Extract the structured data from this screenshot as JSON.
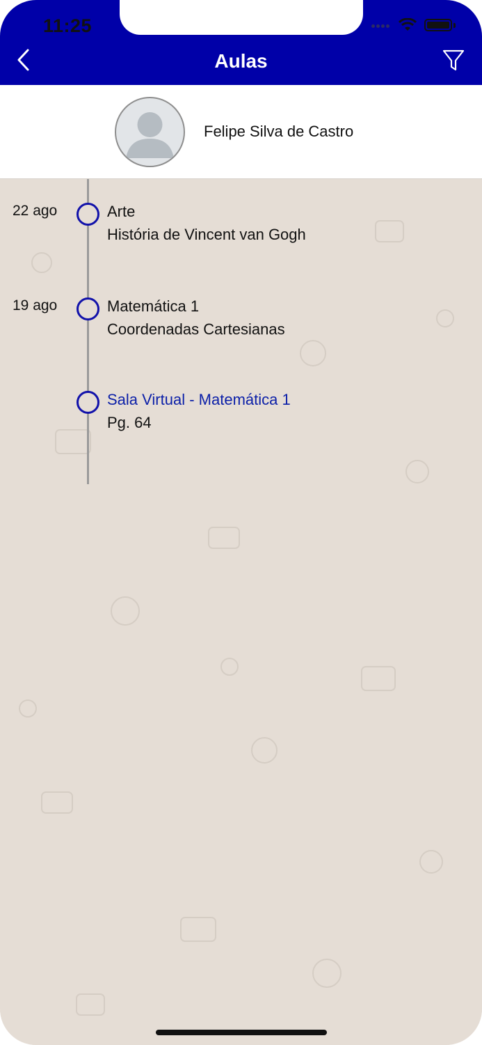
{
  "status_bar": {
    "time": "11:25"
  },
  "header": {
    "title": "Aulas",
    "back_icon": "chevron-left-icon",
    "filter_icon": "filter-icon",
    "color": "#0000a8"
  },
  "profile": {
    "name": "Felipe Silva de Castro"
  },
  "timeline": {
    "entries": [
      {
        "date": "22 ago",
        "title": "Arte",
        "subtitle": "História de Vincent van Gogh",
        "is_link": false
      },
      {
        "date": "19 ago",
        "title": "Matemática 1",
        "subtitle": "Coordenadas Cartesianas",
        "is_link": false
      },
      {
        "date": "",
        "title": "Sala Virtual - Matemática 1",
        "subtitle": "Pg. 64",
        "is_link": true
      }
    ]
  },
  "colors": {
    "accent": "#0000a8",
    "link": "#0b1fa8",
    "background": "#e5ddd5"
  }
}
